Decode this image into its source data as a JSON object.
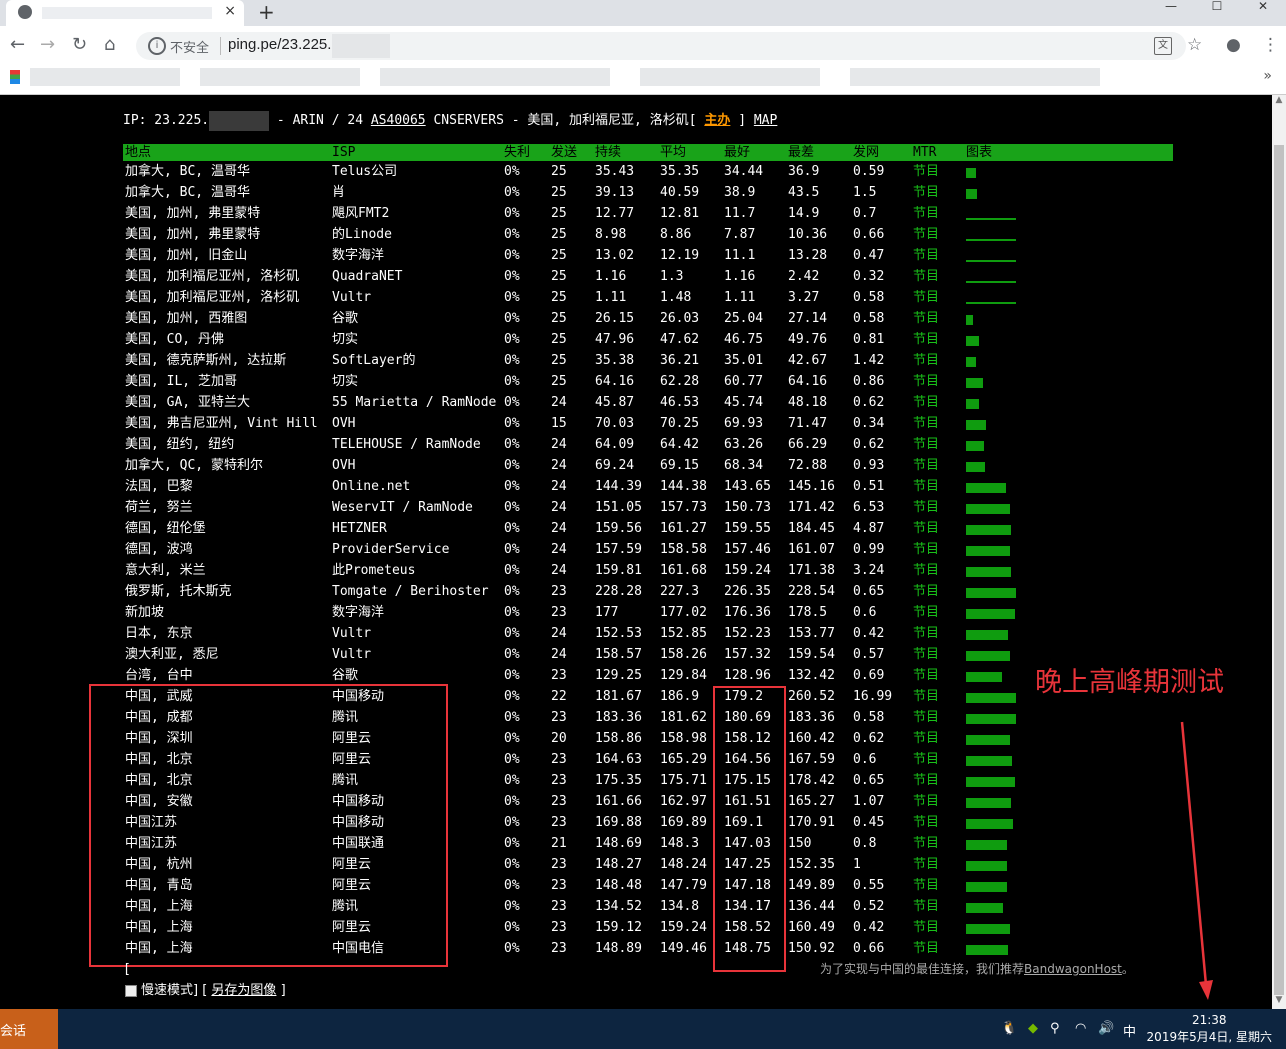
{
  "browser": {
    "tab_close": "×",
    "new_tab": "+",
    "window_buttons": [
      "—",
      "☐",
      "✕"
    ],
    "insecure_label": "不安全",
    "url": "ping.pe/23.225."
  },
  "page": {
    "ip_prefix": "IP: 23.225.",
    "ip_rest": "- ARIN / 24 ",
    "asn": "AS40065",
    "ip_info": " CNSERVERS - 美国, 加利福尼亚, 洛杉矶[ ",
    "host_link": "主办",
    "map_sep": " ] ",
    "map_link": "MAP",
    "headers": [
      "地点",
      "ISP",
      "失利",
      "发送",
      "持续",
      "平均",
      "最好",
      "最差",
      "发网",
      "MTR",
      "图表"
    ],
    "rows": [
      [
        "加拿大, BC, 温哥华",
        "Telus公司",
        "0%",
        "25",
        "35.43",
        "35.35",
        "34.44",
        "36.9",
        "0.59",
        "节目"
      ],
      [
        "加拿大, BC, 温哥华",
        "肖",
        "0%",
        "25",
        "39.13",
        "40.59",
        "38.9",
        "43.5",
        "1.5",
        "节目"
      ],
      [
        "美国, 加州, 弗里蒙特",
        "飓风FMT2",
        "0%",
        "25",
        "12.77",
        "12.81",
        "11.7",
        "14.9",
        "0.7",
        "节目"
      ],
      [
        "美国, 加州, 弗里蒙特",
        "的Linode",
        "0%",
        "25",
        "8.98",
        "8.86",
        "7.87",
        "10.36",
        "0.66",
        "节目"
      ],
      [
        "美国, 加州, 旧金山",
        "数字海洋",
        "0%",
        "25",
        "13.02",
        "12.19",
        "11.1",
        "13.28",
        "0.47",
        "节目"
      ],
      [
        "美国, 加利福尼亚州, 洛杉矶",
        "QuadraNET",
        "0%",
        "25",
        "1.16",
        "1.3",
        "1.16",
        "2.42",
        "0.32",
        "节目"
      ],
      [
        "美国, 加利福尼亚州, 洛杉矶",
        "Vultr",
        "0%",
        "25",
        "1.11",
        "1.48",
        "1.11",
        "3.27",
        "0.58",
        "节目"
      ],
      [
        "美国, 加州, 西雅图",
        "谷歌",
        "0%",
        "25",
        "26.15",
        "26.03",
        "25.04",
        "27.14",
        "0.58",
        "节目"
      ],
      [
        "美国, CO, 丹佛",
        "切实",
        "0%",
        "25",
        "47.96",
        "47.62",
        "46.75",
        "49.76",
        "0.81",
        "节目"
      ],
      [
        "美国, 德克萨斯州, 达拉斯",
        "SoftLayer的",
        "0%",
        "25",
        "35.38",
        "36.21",
        "35.01",
        "42.67",
        "1.42",
        "节目"
      ],
      [
        "美国, IL, 芝加哥",
        "切实",
        "0%",
        "25",
        "64.16",
        "62.28",
        "60.77",
        "64.16",
        "0.86",
        "节目"
      ],
      [
        "美国, GA, 亚特兰大",
        "55 Marietta / RamNode",
        "0%",
        "24",
        "45.87",
        "46.53",
        "45.74",
        "48.18",
        "0.62",
        "节目"
      ],
      [
        "美国, 弗吉尼亚州, Vint Hill",
        "OVH",
        "0%",
        "15",
        "70.03",
        "70.25",
        "69.93",
        "71.47",
        "0.34",
        "节目"
      ],
      [
        "美国, 纽约, 纽约",
        "TELEHOUSE / RamNode",
        "0%",
        "24",
        "64.09",
        "64.42",
        "63.26",
        "66.29",
        "0.62",
        "节目"
      ],
      [
        "加拿大, QC, 蒙特利尔",
        "OVH",
        "0%",
        "24",
        "69.24",
        "69.15",
        "68.34",
        "72.88",
        "0.93",
        "节目"
      ],
      [
        "法国, 巴黎",
        "Online.net",
        "0%",
        "24",
        "144.39",
        "144.38",
        "143.65",
        "145.16",
        "0.51",
        "节目"
      ],
      [
        "荷兰, 努兰",
        "WeservIT / RamNode",
        "0%",
        "24",
        "151.05",
        "157.73",
        "150.73",
        "171.42",
        "6.53",
        "节目"
      ],
      [
        "德国, 纽伦堡",
        "HETZNER",
        "0%",
        "24",
        "159.56",
        "161.27",
        "159.55",
        "184.45",
        "4.87",
        "节目"
      ],
      [
        "德国, 波鸿",
        "ProviderService",
        "0%",
        "24",
        "157.59",
        "158.58",
        "157.46",
        "161.07",
        "0.99",
        "节目"
      ],
      [
        "意大利, 米兰",
        "此Prometeus",
        "0%",
        "24",
        "159.81",
        "161.68",
        "159.24",
        "171.38",
        "3.24",
        "节目"
      ],
      [
        "俄罗斯, 托木斯克",
        "Tomgate / Berihoster",
        "0%",
        "23",
        "228.28",
        "227.3",
        "226.35",
        "228.54",
        "0.65",
        "节目"
      ],
      [
        "新加坡",
        "数字海洋",
        "0%",
        "23",
        "177",
        "177.02",
        "176.36",
        "178.5",
        "0.6",
        "节目"
      ],
      [
        "日本, 东京",
        "Vultr",
        "0%",
        "24",
        "152.53",
        "152.85",
        "152.23",
        "153.77",
        "0.42",
        "节目"
      ],
      [
        "澳大利亚, 悉尼",
        "Vultr",
        "0%",
        "24",
        "158.57",
        "158.26",
        "157.32",
        "159.54",
        "0.57",
        "节目"
      ],
      [
        "台湾, 台中",
        "谷歌",
        "0%",
        "23",
        "129.25",
        "129.84",
        "128.96",
        "132.42",
        "0.69",
        "节目"
      ],
      [
        "中国, 武威",
        "中国移动",
        "0%",
        "22",
        "181.67",
        "186.9",
        "179.2",
        "260.52",
        "16.99",
        "节目"
      ],
      [
        "中国, 成都",
        "腾讯",
        "0%",
        "23",
        "183.36",
        "181.62",
        "180.69",
        "183.36",
        "0.58",
        "节目"
      ],
      [
        "中国, 深圳",
        "阿里云",
        "0%",
        "20",
        "158.86",
        "158.98",
        "158.12",
        "160.42",
        "0.62",
        "节目"
      ],
      [
        "中国, 北京",
        "阿里云",
        "0%",
        "23",
        "164.63",
        "165.29",
        "164.56",
        "167.59",
        "0.6",
        "节目"
      ],
      [
        "中国, 北京",
        "腾讯",
        "0%",
        "23",
        "175.35",
        "175.71",
        "175.15",
        "178.42",
        "0.65",
        "节目"
      ],
      [
        "中国, 安徽",
        "中国移动",
        "0%",
        "23",
        "161.66",
        "162.97",
        "161.51",
        "165.27",
        "1.07",
        "节目"
      ],
      [
        "中国江苏",
        "中国移动",
        "0%",
        "23",
        "169.88",
        "169.89",
        "169.1",
        "170.91",
        "0.45",
        "节目"
      ],
      [
        "中国江苏",
        "中国联通",
        "0%",
        "21",
        "148.69",
        "148.3",
        "147.03",
        "150",
        "0.8",
        "节目"
      ],
      [
        "中国, 杭州",
        "阿里云",
        "0%",
        "23",
        "148.27",
        "148.24",
        "147.25",
        "152.35",
        "1",
        "节目"
      ],
      [
        "中国, 青岛",
        "阿里云",
        "0%",
        "23",
        "148.48",
        "147.79",
        "147.18",
        "149.89",
        "0.55",
        "节目"
      ],
      [
        "中国, 上海",
        "腾讯",
        "0%",
        "23",
        "134.52",
        "134.8",
        "134.17",
        "136.44",
        "0.52",
        "节目"
      ],
      [
        "中国, 上海",
        "阿里云",
        "0%",
        "23",
        "159.12",
        "159.24",
        "158.52",
        "160.49",
        "0.42",
        "节目"
      ],
      [
        "中国, 上海",
        "中国电信",
        "0%",
        "23",
        "148.89",
        "149.46",
        "148.75",
        "150.92",
        "0.66",
        "节目"
      ]
    ],
    "annotation": "晚上高峰期测试",
    "foot_bracket": "[",
    "slow_mode": "慢速模式] [ ",
    "save_image": "另存为图像",
    "foot_close": " ]",
    "recommend": "为了实现与中国的最佳连接，我们推荐",
    "recommend_link": "BandwagonHost",
    "recommend_end": "。"
  },
  "taskbar": {
    "app_label": "会话",
    "ime": "中",
    "time": "21:38",
    "date": "2019年5月4日, 星期六"
  },
  "colors": {
    "header_green": "#19a319",
    "annotation_red": "#e8343a",
    "host_orange": "#ff9900"
  }
}
